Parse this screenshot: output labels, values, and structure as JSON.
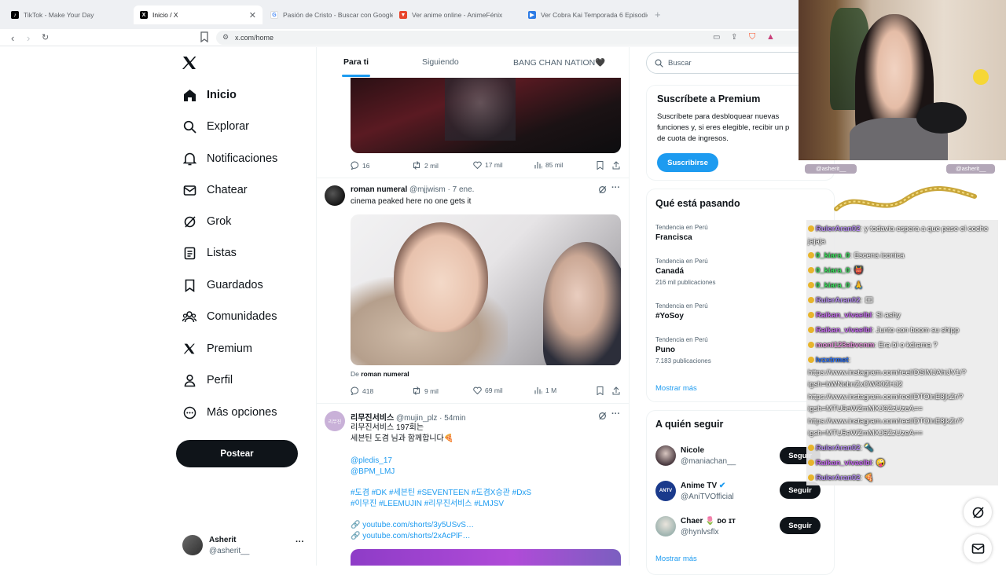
{
  "browser": {
    "tabs": [
      {
        "title": "TikTok - Make Your Day"
      },
      {
        "title": "Inicio / X"
      },
      {
        "title": "Pasión de Cristo - Buscar con Google"
      },
      {
        "title": "Ver anime online - AnimeFénix"
      },
      {
        "title": "Ver Cobra Kai Temporada 6 Episodio"
      }
    ],
    "new_tab": "+",
    "url": "x.com/home"
  },
  "sidebar": {
    "logo": "X",
    "items": [
      {
        "label": "Inicio",
        "icon": "home-icon"
      },
      {
        "label": "Explorar",
        "icon": "search-icon"
      },
      {
        "label": "Notificaciones",
        "icon": "bell-icon"
      },
      {
        "label": "Chatear",
        "icon": "mail-icon"
      },
      {
        "label": "Grok",
        "icon": "grok-icon"
      },
      {
        "label": "Listas",
        "icon": "list-icon"
      },
      {
        "label": "Guardados",
        "icon": "bookmark-icon"
      },
      {
        "label": "Comunidades",
        "icon": "communities-icon"
      },
      {
        "label": "Premium",
        "icon": "x-icon"
      },
      {
        "label": "Perfil",
        "icon": "person-icon"
      },
      {
        "label": "Más opciones",
        "icon": "more-circle-icon"
      }
    ],
    "post_button": "Postear",
    "account": {
      "name": "Asherit",
      "handle": "@asherit__"
    }
  },
  "feed": {
    "tabs": [
      "Para ti",
      "Siguiendo",
      "BANG CHAN NATION🖤"
    ],
    "posts": [
      {
        "stats": {
          "replies": "16",
          "reposts": "2 mil",
          "likes": "17 mil",
          "views": "85 mil"
        }
      },
      {
        "name": "roman numeral",
        "handle": "@mjjwism",
        "time": "· 7 ene.",
        "text": "cinema peaked here no one gets it",
        "from_prefix": "De",
        "from_name": "roman numeral",
        "stats": {
          "replies": "418",
          "reposts": "9 mil",
          "likes": "69 mil",
          "views": "1 M"
        }
      },
      {
        "name": "리무진서비스",
        "handle": "@mujin_plz",
        "time": "· 54min",
        "avatar_text": "리무진",
        "line1": "리무진서비스 197회는",
        "line2": "세븐틴 도겸 님과 함께합니다🍕",
        "mention1": "@pledis_17",
        "mention2": "@BPM_LMJ",
        "tags1": "#도겸 #DK #세븐틴 #SEVENTEEN #도겸X승관 #DxS",
        "tags2": "#이무진 #LEEMUJIN #리무진서비스 #LMJSV",
        "link1": "youtube.com/shorts/3y5USvS…",
        "link2": "youtube.com/shorts/2xAcPlF…"
      }
    ]
  },
  "right": {
    "search_placeholder": "Buscar",
    "premium": {
      "title": "Suscríbete a Premium",
      "line1": "Suscríbete para desbloquear nuevas",
      "line2": "funciones y, si eres elegible, recibir un p",
      "line3": "de cuota de ingresos.",
      "button": "Suscribirse"
    },
    "trends": {
      "title": "Qué está pasando",
      "items": [
        {
          "context": "Tendencia en Perú",
          "name": "Francisca",
          "count": ""
        },
        {
          "context": "Tendencia en Perú",
          "name": "Canadá",
          "count": "216 mil publicaciones"
        },
        {
          "context": "Tendencia en Perú",
          "name": "#YoSoy",
          "count": ""
        },
        {
          "context": "Tendencia en Perú",
          "name": "Puno",
          "count": "7.183 publicaciones"
        }
      ],
      "more": "Mostrar más"
    },
    "follow": {
      "title": "A quién seguir",
      "items": [
        {
          "name": "Nicole",
          "handle": "@maniachan__",
          "button": "Seguir"
        },
        {
          "name": "Anime TV",
          "handle": "@AniTVOfficial",
          "button": "Seguir"
        },
        {
          "name": "Chaer 🌷 ᴅᴏ ɪᴛ",
          "handle": "@hynlvsflx",
          "button": "Seguir"
        }
      ],
      "more": "Mostrar más"
    }
  },
  "stream": {
    "tag_left": "@asherit__",
    "tag_right": "@asherit__",
    "chat": [
      {
        "user": "RulerAran02",
        "color": "#b58cf0",
        "msg": ": y todavia espera a que pase el coche jajaja"
      },
      {
        "user": "0_kiara_0",
        "color": "#37e05a",
        "msg": ": Escena iconica"
      },
      {
        "user": "0_kiara_0",
        "color": "#37e05a",
        "msg": ": 👹"
      },
      {
        "user": "0_kiara_0",
        "color": "#37e05a",
        "msg": ": 🙏"
      },
      {
        "user": "RulerAran02",
        "color": "#b58cf0",
        "msg": ": 🎞"
      },
      {
        "user": "Raikan_vivaelbl",
        "color": "#c76cf0",
        "msg": ": Si ashy"
      },
      {
        "user": "Raikan_vivaelbl",
        "color": "#c76cf0",
        "msg": ": Junto con boom su shipp"
      },
      {
        "user": "moni123abvcnm",
        "color": "#e38fd9",
        "msg": ": Era bl o kdrama ?"
      },
      {
        "user": "lvzxtrmet",
        "color": "#2a6df0",
        "msg": ": https://www.instagram.com/reel/DSIMJAhiJV1/?igsh=bWNobnZxOW90ZHJ2 https://www.instagram.com/reel/DTOlnE8jkZr/?igsh=MTU5eWZmMXJ6ZzUzeA== https://www.instagram.com/reel/DTOlnE8jkZr/?igsh=MTU5eWZmMXJ6ZzUzeA=="
      },
      {
        "user": "RulerAran02",
        "color": "#b58cf0",
        "msg": ": 🔦"
      },
      {
        "user": "Raikan_vivaelbl",
        "color": "#c76cf0",
        "msg": ": 🤪"
      },
      {
        "user": "RulerAran02",
        "color": "#b58cf0",
        "msg": ": 🍕"
      }
    ]
  }
}
